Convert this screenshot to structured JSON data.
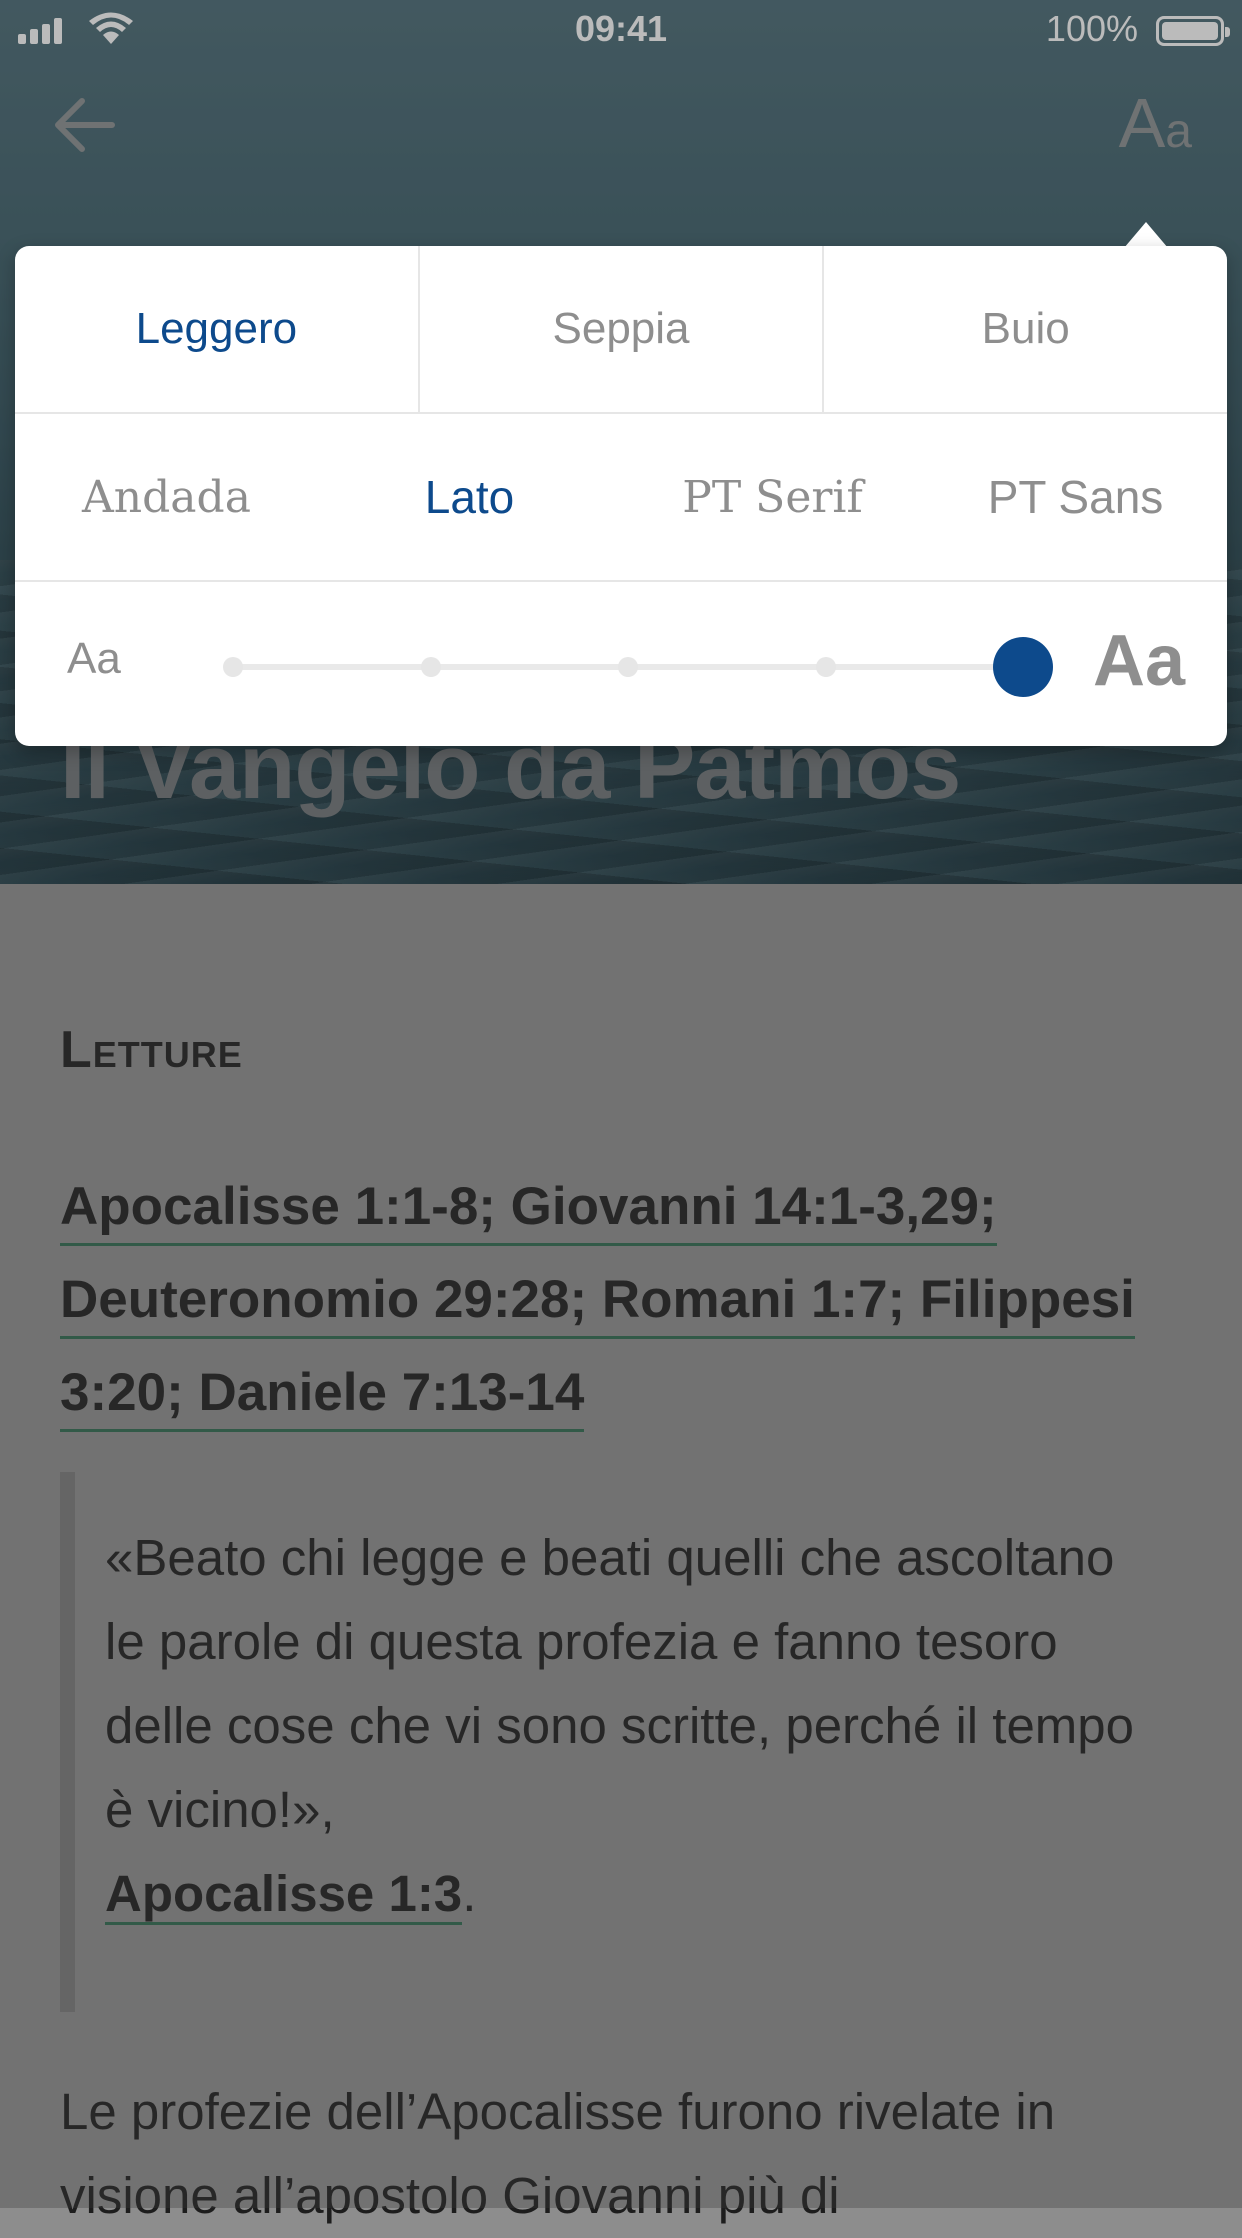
{
  "status_bar": {
    "time": "09:41",
    "battery": "100%"
  },
  "hero": {
    "title": "Il Vangelo da Patmos"
  },
  "nav": {
    "aa_big": "A",
    "aa_small": "a"
  },
  "settings": {
    "themes": [
      "Leggero",
      "Seppia",
      "Buio"
    ],
    "active_theme": "Leggero",
    "fonts": [
      "Andada",
      "Lato",
      "PT Serif",
      "PT Sans"
    ],
    "active_font": "Lato",
    "size_small_label": "Aa",
    "size_large_label": "Aa",
    "size_level": 5,
    "size_steps": 5
  },
  "content": {
    "section_title": "Letture",
    "refs": [
      "Apocalisse 1:1-8; Giovanni 14:1-3,29;",
      "Deuteronomio 29:28; Romani 1:7; Filippesi",
      "3:20; Daniele 7:13-14"
    ],
    "quote": "«Beato chi legge e beati quelli che ascoltano le parole di questa profezia e fanno tesoro delle cose che vi sono scritte, perché il tempo è vicino!»,",
    "quote_source": "Apocalisse 1:3",
    "quote_end": ".",
    "body": "Le profezie dell’Apocalisse furono rivelate in visione all’apostolo Giovanni più di"
  },
  "colors": {
    "accent": "#0d4a8c",
    "link_underline": "#2d6a4f"
  }
}
